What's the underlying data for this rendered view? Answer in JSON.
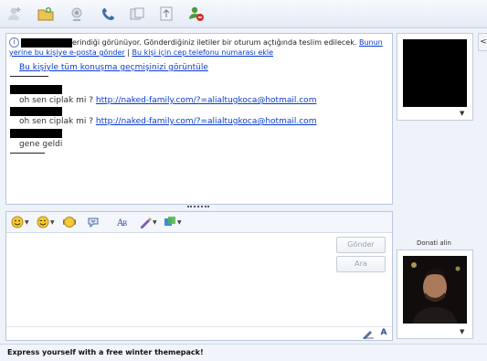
{
  "toolbar": {
    "icons": [
      "invite-icon",
      "send-files-icon",
      "webcam-icon",
      "call-icon",
      "share-folder-icon",
      "activities-icon",
      "block-icon"
    ]
  },
  "conversation": {
    "info_text": "erindiği görünüyor. Gönderdiğiniz iletiler bir oturum açtığında teslim edilecek.",
    "email_link": "Bunun yerine bu kişiye e-posta gönder",
    "separator": "|",
    "phone_link": "Bu kişi için cep telefonu numarası ekle",
    "history_link": "Bu kişiyle tüm konuşma geçmişinizi görüntüle",
    "messages": [
      {
        "text": "oh sen ciplak mi ?",
        "link": "http://naked-family.com/?=alialtugkoca@hotmail.com"
      },
      {
        "text": "oh sen ciplak mi ?",
        "link": "http://naked-family.com/?=alialtugkoca@hotmail.com"
      },
      {
        "text": "gene geldi",
        "link": ""
      }
    ]
  },
  "input": {
    "send_label": "Gönder",
    "search_label": "Ara"
  },
  "sidebar": {
    "donate_label": "Donati alin",
    "collapse_glyph": "<"
  },
  "status": {
    "text": "Express yourself with a free winter themepack!"
  }
}
